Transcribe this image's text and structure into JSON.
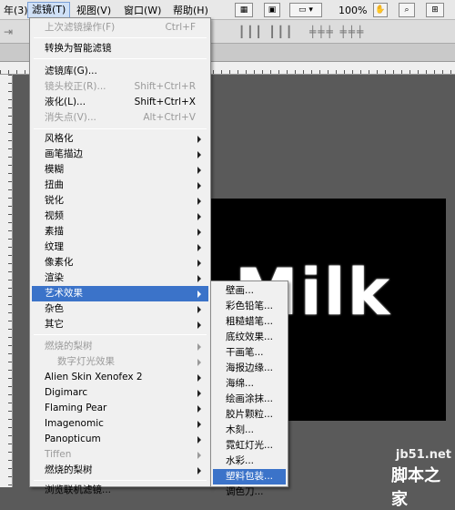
{
  "menubar": {
    "items": [
      {
        "label": "年(3)",
        "active": false
      },
      {
        "label": "滤镜(T)",
        "active": true
      },
      {
        "label": "视图(V)",
        "active": false
      },
      {
        "label": "窗口(W)",
        "active": false
      },
      {
        "label": "帮助(H)",
        "active": false
      }
    ],
    "zoom": "100%"
  },
  "filter_menu": {
    "items": [
      {
        "label": "上次滤镜操作(F)",
        "shortcut": "Ctrl+F",
        "disabled": true,
        "submenu": false
      },
      {
        "label": "转换为智能滤镜",
        "shortcut": "",
        "disabled": false,
        "submenu": false
      },
      {
        "label": "滤镜库(G)...",
        "shortcut": "",
        "disabled": false,
        "submenu": false
      },
      {
        "label": "镜头校正(R)...",
        "shortcut": "Shift+Ctrl+R",
        "disabled": true,
        "submenu": false
      },
      {
        "label": "液化(L)...",
        "shortcut": "Shift+Ctrl+X",
        "disabled": false,
        "submenu": false
      },
      {
        "label": "消失点(V)...",
        "shortcut": "Alt+Ctrl+V",
        "disabled": true,
        "submenu": false
      },
      {
        "label": "风格化",
        "shortcut": "",
        "disabled": false,
        "submenu": true
      },
      {
        "label": "画笔描边",
        "shortcut": "",
        "disabled": false,
        "submenu": true
      },
      {
        "label": "模糊",
        "shortcut": "",
        "disabled": false,
        "submenu": true
      },
      {
        "label": "扭曲",
        "shortcut": "",
        "disabled": false,
        "submenu": true
      },
      {
        "label": "锐化",
        "shortcut": "",
        "disabled": false,
        "submenu": true
      },
      {
        "label": "视频",
        "shortcut": "",
        "disabled": false,
        "submenu": true
      },
      {
        "label": "素描",
        "shortcut": "",
        "disabled": false,
        "submenu": true
      },
      {
        "label": "纹理",
        "shortcut": "",
        "disabled": false,
        "submenu": true
      },
      {
        "label": "像素化",
        "shortcut": "",
        "disabled": false,
        "submenu": true
      },
      {
        "label": "渲染",
        "shortcut": "",
        "disabled": false,
        "submenu": true
      },
      {
        "label": "艺术效果",
        "shortcut": "",
        "disabled": false,
        "submenu": true,
        "selected": true
      },
      {
        "label": "杂色",
        "shortcut": "",
        "disabled": false,
        "submenu": true
      },
      {
        "label": "其它",
        "shortcut": "",
        "disabled": false,
        "submenu": true
      },
      {
        "label": "燃烧的梨树",
        "shortcut": "",
        "disabled": true,
        "submenu": true
      },
      {
        "label": "数字灯光效果",
        "shortcut": "",
        "disabled": true,
        "submenu": true
      },
      {
        "label": "Alien Skin Xenofex 2",
        "shortcut": "",
        "disabled": false,
        "submenu": true
      },
      {
        "label": "Digimarc",
        "shortcut": "",
        "disabled": false,
        "submenu": true
      },
      {
        "label": "Flaming Pear",
        "shortcut": "",
        "disabled": false,
        "submenu": true
      },
      {
        "label": "Imagenomic",
        "shortcut": "",
        "disabled": false,
        "submenu": true
      },
      {
        "label": "Panopticum",
        "shortcut": "",
        "disabled": false,
        "submenu": true
      },
      {
        "label": "Tiffen",
        "shortcut": "",
        "disabled": true,
        "submenu": true
      },
      {
        "label": "燃烧的梨树",
        "shortcut": "",
        "disabled": false,
        "submenu": true
      },
      {
        "label": "浏览联机滤镜...",
        "shortcut": "",
        "disabled": false,
        "submenu": false
      }
    ]
  },
  "artistic_submenu": {
    "items": [
      {
        "label": "壁画..."
      },
      {
        "label": "彩色铅笔..."
      },
      {
        "label": "粗糙蜡笔..."
      },
      {
        "label": "底纹效果..."
      },
      {
        "label": "干画笔..."
      },
      {
        "label": "海报边缘..."
      },
      {
        "label": "海绵..."
      },
      {
        "label": "绘画涂抹..."
      },
      {
        "label": "胶片颗粒..."
      },
      {
        "label": "木刻..."
      },
      {
        "label": "霓虹灯光..."
      },
      {
        "label": "水彩..."
      },
      {
        "label": "塑料包装...",
        "selected": true
      },
      {
        "label": "调色刀..."
      }
    ]
  },
  "canvas": {
    "text": "Milk"
  },
  "watermark": {
    "url": "jb51.net",
    "text": "脚本之家"
  }
}
